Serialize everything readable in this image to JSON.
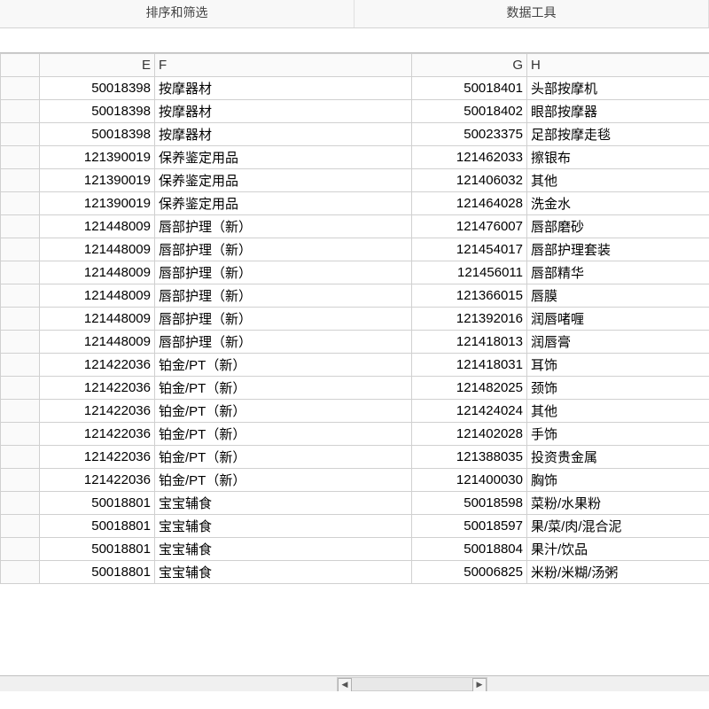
{
  "ribbon": {
    "group_sort_filter": "排序和筛选",
    "group_data_tools": "数据工具"
  },
  "columns": [
    "E",
    "F",
    "G",
    "H"
  ],
  "rows": [
    {
      "E": "50018398",
      "F": "按摩器材",
      "G": "50018401",
      "H": "头部按摩机"
    },
    {
      "E": "50018398",
      "F": "按摩器材",
      "G": "50018402",
      "H": "眼部按摩器"
    },
    {
      "E": "50018398",
      "F": "按摩器材",
      "G": "50023375",
      "H": "足部按摩走毯"
    },
    {
      "E": "121390019",
      "F": "保养鉴定用品",
      "G": "121462033",
      "H": "擦银布"
    },
    {
      "E": "121390019",
      "F": "保养鉴定用品",
      "G": "121406032",
      "H": "其他"
    },
    {
      "E": "121390019",
      "F": "保养鉴定用品",
      "G": "121464028",
      "H": "洗金水"
    },
    {
      "E": "121448009",
      "F": "唇部护理（新）",
      "G": "121476007",
      "H": "唇部磨砂"
    },
    {
      "E": "121448009",
      "F": "唇部护理（新）",
      "G": "121454017",
      "H": "唇部护理套装"
    },
    {
      "E": "121448009",
      "F": "唇部护理（新）",
      "G": "121456011",
      "H": "唇部精华"
    },
    {
      "E": "121448009",
      "F": "唇部护理（新）",
      "G": "121366015",
      "H": "唇膜"
    },
    {
      "E": "121448009",
      "F": "唇部护理（新）",
      "G": "121392016",
      "H": "润唇啫喱"
    },
    {
      "E": "121448009",
      "F": "唇部护理（新）",
      "G": "121418013",
      "H": "润唇膏"
    },
    {
      "E": "121422036",
      "F": "铂金/PT（新）",
      "G": "121418031",
      "H": "耳饰"
    },
    {
      "E": "121422036",
      "F": "铂金/PT（新）",
      "G": "121482025",
      "H": "颈饰"
    },
    {
      "E": "121422036",
      "F": "铂金/PT（新）",
      "G": "121424024",
      "H": "其他"
    },
    {
      "E": "121422036",
      "F": "铂金/PT（新）",
      "G": "121402028",
      "H": "手饰"
    },
    {
      "E": "121422036",
      "F": "铂金/PT（新）",
      "G": "121388035",
      "H": "投资贵金属"
    },
    {
      "E": "121422036",
      "F": "铂金/PT（新）",
      "G": "121400030",
      "H": "胸饰"
    },
    {
      "E": "50018801",
      "F": "宝宝辅食",
      "G": "50018598",
      "H": "菜粉/水果粉"
    },
    {
      "E": "50018801",
      "F": "宝宝辅食",
      "G": "50018597",
      "H": "果/菜/肉/混合泥"
    },
    {
      "E": "50018801",
      "F": "宝宝辅食",
      "G": "50018804",
      "H": "果汁/饮品"
    },
    {
      "E": "50018801",
      "F": "宝宝辅食",
      "G": "50006825",
      "H": "米粉/米糊/汤粥"
    }
  ],
  "scroll": {
    "left_icon": "◀",
    "right_icon": "▶"
  }
}
